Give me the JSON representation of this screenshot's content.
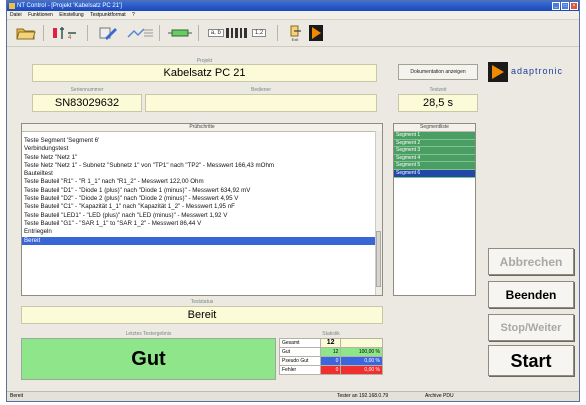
{
  "window": {
    "title": "NT Control - [Projekt 'Kabelsatz PC 21']",
    "controls": {
      "minimize": "_",
      "maximize": "□",
      "close": "×"
    }
  },
  "menu": [
    "Datei",
    "Funktionen",
    "Einstellung",
    "Testpunktformat",
    "?"
  ],
  "toolbar": {
    "ab_label": "a, b",
    "num_label": "1,2",
    "exit_label": "Exit"
  },
  "project": {
    "label": "Projekt",
    "value": "Kabelsatz PC 21"
  },
  "doc_button": "Dokumentation anzeigen",
  "brand": {
    "name": "adaptronic",
    "colors": {
      "orange": "#f08a00",
      "blue": "#1e3f9a"
    }
  },
  "serial": {
    "label": "Seriennummer",
    "value": "SN83029632"
  },
  "operator": {
    "label": "Bediener",
    "value": ""
  },
  "testtime": {
    "label": "Testzeit",
    "value": "28,5 s"
  },
  "steps": {
    "label": "Prüfschritte",
    "lines": [
      "Teste Segment 'Segment 6'",
      "Verbindungstest",
      "Teste Netz \"Netz 1\"",
      "Teste Netz \"Netz 1\" - Subnetz \"Subnetz 1\" von \"TP1\" nach \"TP2\" - Messwert 166,43 mOhm",
      "Bauteiltest",
      "Teste Bauteil \"R1\" - \"R 1_1\" nach \"R1_2\" - Messwert 122,00 Ohm",
      "Teste Bauteil \"D1\" - \"Diode 1 (plus)\" nach \"Diode 1 (minus)\" - Messwert 634,92 mV",
      "Teste Bauteil \"D2\" - \"Diode 2 (plus)\" nach \"Diode 2 (minus)\" - Messwert 4,95 V",
      "Teste Bauteil \"C1\" - \"Kapazität 1_1\" nach \"Kapazität 1_2\" - Messwert 1,95 nF",
      "Teste Bauteil \"LED1\" - \"LED (plus)\" nach \"LED (minus)\" - Messwert 1,92 V",
      "Teste Bauteil \"G1\" - \"SAR 1_1\" to \"SAR 1_2\" - Messwert 86,44 V",
      "Entriegeln",
      "Bereit"
    ],
    "selected_index": 12
  },
  "segments": {
    "label": "Segmentliste",
    "items": [
      "Segment 1",
      "Segment 2",
      "Segment 3",
      "Segment 4",
      "Segment 5",
      "Segment 6"
    ],
    "selected_index": 5
  },
  "buttons": {
    "abort": "Abbrechen",
    "quit": "Beenden",
    "stopcontinue": "Stop/Weiter",
    "start": "Start"
  },
  "teststatus": {
    "label": "Teststatus",
    "value": "Bereit"
  },
  "last_result": {
    "label": "Letztes Testergebnis",
    "value": "Gut",
    "color": "#8ee58a"
  },
  "statistics": {
    "label": "Statistik",
    "rows": [
      {
        "name": "Gesamt",
        "count": "12",
        "percent": "",
        "color": "#fbfbd8"
      },
      {
        "name": "Gut",
        "count": "12",
        "percent": "100,00 %",
        "color": "#8ee58a"
      },
      {
        "name": "Pseudo Gut",
        "count": "0",
        "percent": "0,00 %",
        "color": "#3a66e0"
      },
      {
        "name": "Fehler",
        "count": "0",
        "percent": "0,00 %",
        "color": "#ee3030"
      }
    ]
  },
  "statusbar": {
    "left": "Bereit",
    "middle": "Tester an 192.168.0.79",
    "right": "Archive PDU"
  }
}
